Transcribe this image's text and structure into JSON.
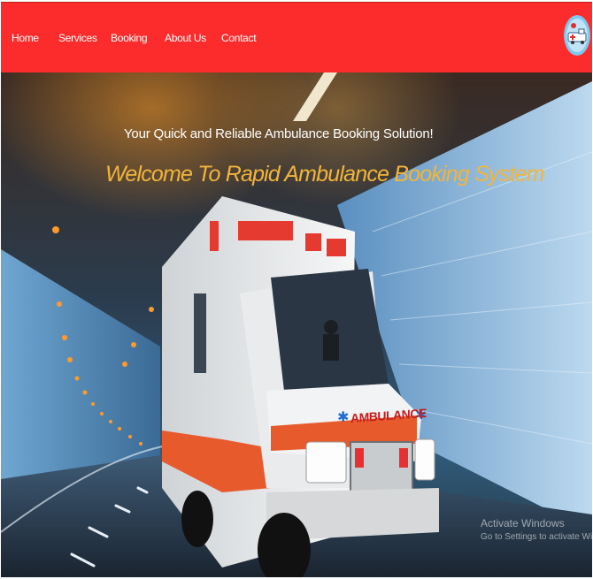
{
  "nav": {
    "items": [
      {
        "label": "Home"
      },
      {
        "label": "Services"
      },
      {
        "label": "Booking"
      },
      {
        "label": "About Us"
      },
      {
        "label": "Contact"
      }
    ],
    "background": "#fd2c2c"
  },
  "hero": {
    "tagline": "Your Quick and Reliable Ambulance Booking Solution!",
    "welcome": "Welcome To Rapid Ambulance Booking System",
    "welcome_color": "#f2b53a",
    "ambulance_label": "AMBULANCE"
  },
  "watermark": {
    "title": "Activate Windows",
    "subtitle": "Go to Settings to activate Windows."
  }
}
